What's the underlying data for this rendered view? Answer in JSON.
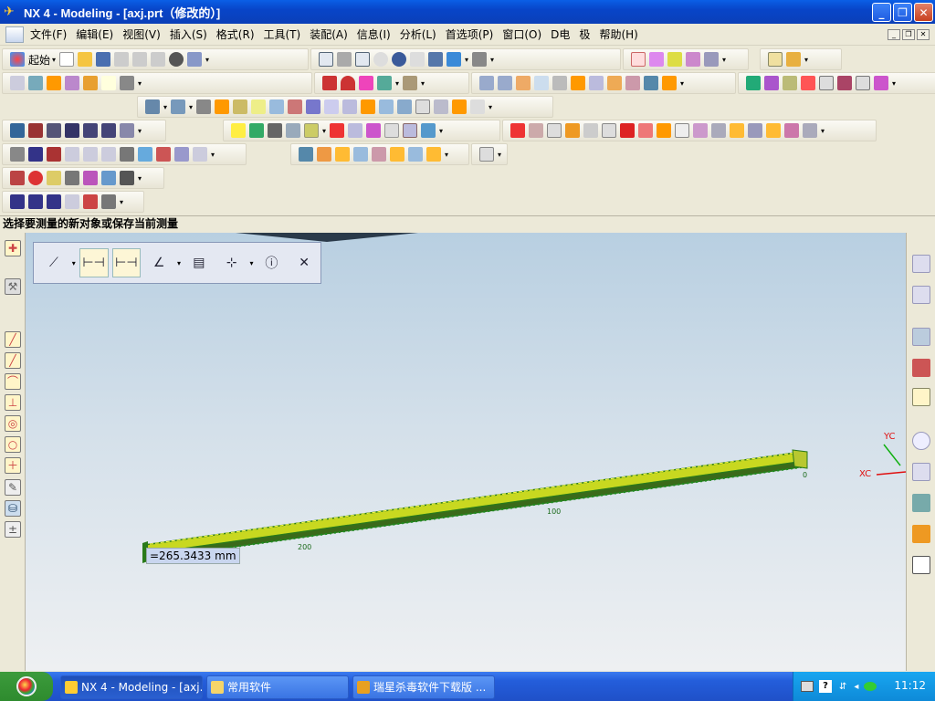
{
  "window": {
    "title": "NX 4 - Modeling - [axj.prt（修改的）]",
    "minimize_glyph": "_",
    "restore_glyph": "❐",
    "close_glyph": "✕"
  },
  "menu": {
    "items": [
      "文件(F)",
      "编辑(E)",
      "视图(V)",
      "插入(S)",
      "格式(R)",
      "工具(T)",
      "装配(A)",
      "信息(I)",
      "分析(L)",
      "首选项(P)",
      "窗口(O)",
      "D电",
      "极",
      "帮助(H)"
    ]
  },
  "toolbar": {
    "start_label": "起始"
  },
  "cue_line": "选择要测量的新对象或保存当前测量",
  "viewport": {
    "measurement_readout": "=265.3433 mm",
    "scale_labels": [
      "200",
      "100",
      "0"
    ],
    "axis_labels": {
      "yc": "YC",
      "xc": "XC"
    }
  },
  "measure_toolbar": {
    "icons": [
      "dimension-icon",
      "measure-length-icon",
      "measure-offset-icon",
      "curve-analysis-icon",
      "p1-p2-icon",
      "point-to-point-icon",
      "info-icon",
      "close-icon"
    ]
  },
  "taskbar": {
    "items": [
      "NX 4 - Modeling - [axj.p...",
      "常用软件",
      "瑞星杀毒软件下载版 ..."
    ],
    "clock": "11:12"
  },
  "colors": {
    "title_blue": "#0a4fd6",
    "beam_yellow": "#c8d820",
    "beam_green": "#2a7a1a",
    "axis_red": "#e01010",
    "axis_green": "#10b010"
  }
}
